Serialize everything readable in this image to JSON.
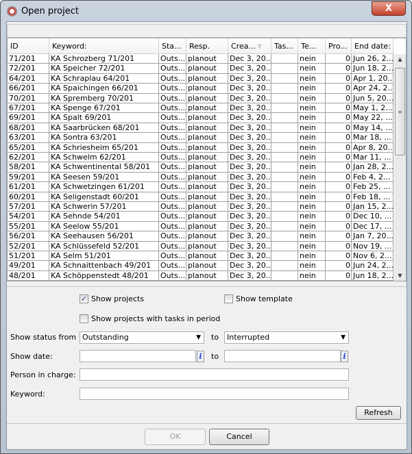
{
  "window": {
    "title": "Open project",
    "close_label": "X"
  },
  "table": {
    "columns": [
      "ID",
      "Keyword:",
      "Sta...",
      "Resp.",
      "Crea...",
      "Tas...",
      "Te...",
      "Pro...",
      "End date:"
    ],
    "sort_indicator": "▿",
    "rows": [
      [
        "71/201",
        "KA Schrozberg 71/201",
        "Outs...",
        "planout",
        "Dec 3, 20...",
        "",
        "nein",
        "0",
        "Jun 26, 2..."
      ],
      [
        "72/201",
        "KA Speicher 72/201",
        "Outs...",
        "planout",
        "Dec 3, 20...",
        "",
        "nein",
        "0",
        "Jun 18, 2..."
      ],
      [
        "64/201",
        "KA Schraplau 64/201",
        "Outs...",
        "planout",
        "Dec 3, 20...",
        "",
        "nein",
        "0",
        "Apr 1, 20..."
      ],
      [
        "66/201",
        "KA Spaichingen 66/201",
        "Outs...",
        "planout",
        "Dec 3, 20...",
        "",
        "nein",
        "0",
        "Apr 24, 2..."
      ],
      [
        "70/201",
        "KA Spremberg 70/201",
        "Outs...",
        "planout",
        "Dec 3, 20...",
        "",
        "nein",
        "0",
        "Jun 5, 20..."
      ],
      [
        "67/201",
        "KA Spenge 67/201",
        "Outs...",
        "planout",
        "Dec 3, 20...",
        "",
        "nein",
        "0",
        "May 1, 2..."
      ],
      [
        "69/201",
        "KA Spalt 69/201",
        "Outs...",
        "planout",
        "Dec 3, 20...",
        "",
        "nein",
        "0",
        "May 22, ..."
      ],
      [
        "68/201",
        "KA Saarbrücken 68/201",
        "Outs...",
        "planout",
        "Dec 3, 20...",
        "",
        "nein",
        "0",
        "May 14, ..."
      ],
      [
        "63/201",
        "KA Sontra 63/201",
        "Outs...",
        "planout",
        "Dec 3, 20...",
        "",
        "nein",
        "0",
        "Mar 18, ..."
      ],
      [
        "65/201",
        "KA Schriesheim 65/201",
        "Outs...",
        "planout",
        "Dec 3, 20...",
        "",
        "nein",
        "0",
        "Apr 8, 20..."
      ],
      [
        "62/201",
        "KA Schwelm 62/201",
        "Outs...",
        "planout",
        "Dec 3, 20...",
        "",
        "nein",
        "0",
        "Mar 11, ..."
      ],
      [
        "58/201",
        "KA Schwentinental 58/201",
        "Outs...",
        "planout",
        "Dec 3, 20...",
        "",
        "nein",
        "0",
        "Jan 28, 2..."
      ],
      [
        "59/201",
        "KA Seesen 59/201",
        "Outs...",
        "planout",
        "Dec 3, 20...",
        "",
        "nein",
        "0",
        "Feb 4, 2..."
      ],
      [
        "61/201",
        "KA Schwetzingen 61/201",
        "Outs...",
        "planout",
        "Dec 3, 20...",
        "",
        "nein",
        "0",
        "Feb 25, ..."
      ],
      [
        "60/201",
        "KA Seligenstadt 60/201",
        "Outs...",
        "planout",
        "Dec 3, 20...",
        "",
        "nein",
        "0",
        "Feb 18, ..."
      ],
      [
        "57/201",
        "KA Schwerin 57/201",
        "Outs...",
        "planout",
        "Dec 3, 20...",
        "",
        "nein",
        "0",
        "Jan 15, 2..."
      ],
      [
        "54/201",
        "KA Sehnde 54/201",
        "Outs...",
        "planout",
        "Dec 3, 20...",
        "",
        "nein",
        "0",
        "Dec 10, ..."
      ],
      [
        "55/201",
        "KA Seelow 55/201",
        "Outs...",
        "planout",
        "Dec 3, 20...",
        "",
        "nein",
        "0",
        "Dec 17, ..."
      ],
      [
        "56/201",
        "KA Seehausen 56/201",
        "Outs...",
        "planout",
        "Dec 3, 20...",
        "",
        "nein",
        "0",
        "Jan 7, 20..."
      ],
      [
        "52/201",
        "KA Schlüssefeld 52/201",
        "Outs...",
        "planout",
        "Dec 3, 20...",
        "",
        "nein",
        "0",
        "Nov 19, ..."
      ],
      [
        "51/201",
        "KA Selm 51/201",
        "Outs...",
        "planout",
        "Dec 3, 20...",
        "",
        "nein",
        "0",
        "Nov 6, 2..."
      ],
      [
        "49/201",
        "KA Schnaittenbach 49/201",
        "Outs...",
        "planout",
        "Dec 3, 20...",
        "",
        "nein",
        "0",
        "Jun 24, 2..."
      ],
      [
        "48/201",
        "KA Schöppenstedt 48/201",
        "Outs...",
        "planout",
        "Dec 3, 20...",
        "",
        "nein",
        "0",
        "Jun 18, 2..."
      ]
    ]
  },
  "filters": {
    "show_projects": {
      "label": "Show projects",
      "checked": true
    },
    "show_template": {
      "label": "Show template",
      "checked": false
    },
    "show_tasks_period": {
      "label": "Show projects with tasks in period",
      "checked": false
    },
    "status_label": "Show status from",
    "status_from": "Outstanding",
    "to_label": "to",
    "status_to": "Interrupted",
    "date_label": "Show date:",
    "date_from": "",
    "date_to": "",
    "info_icon": "i",
    "person_label": "Person in charge:",
    "person_value": "",
    "keyword_label": "Keyword:",
    "keyword_value": "",
    "refresh_label": "Refresh"
  },
  "buttons": {
    "ok": "OK",
    "cancel": "Cancel",
    "ok_enabled": false
  }
}
